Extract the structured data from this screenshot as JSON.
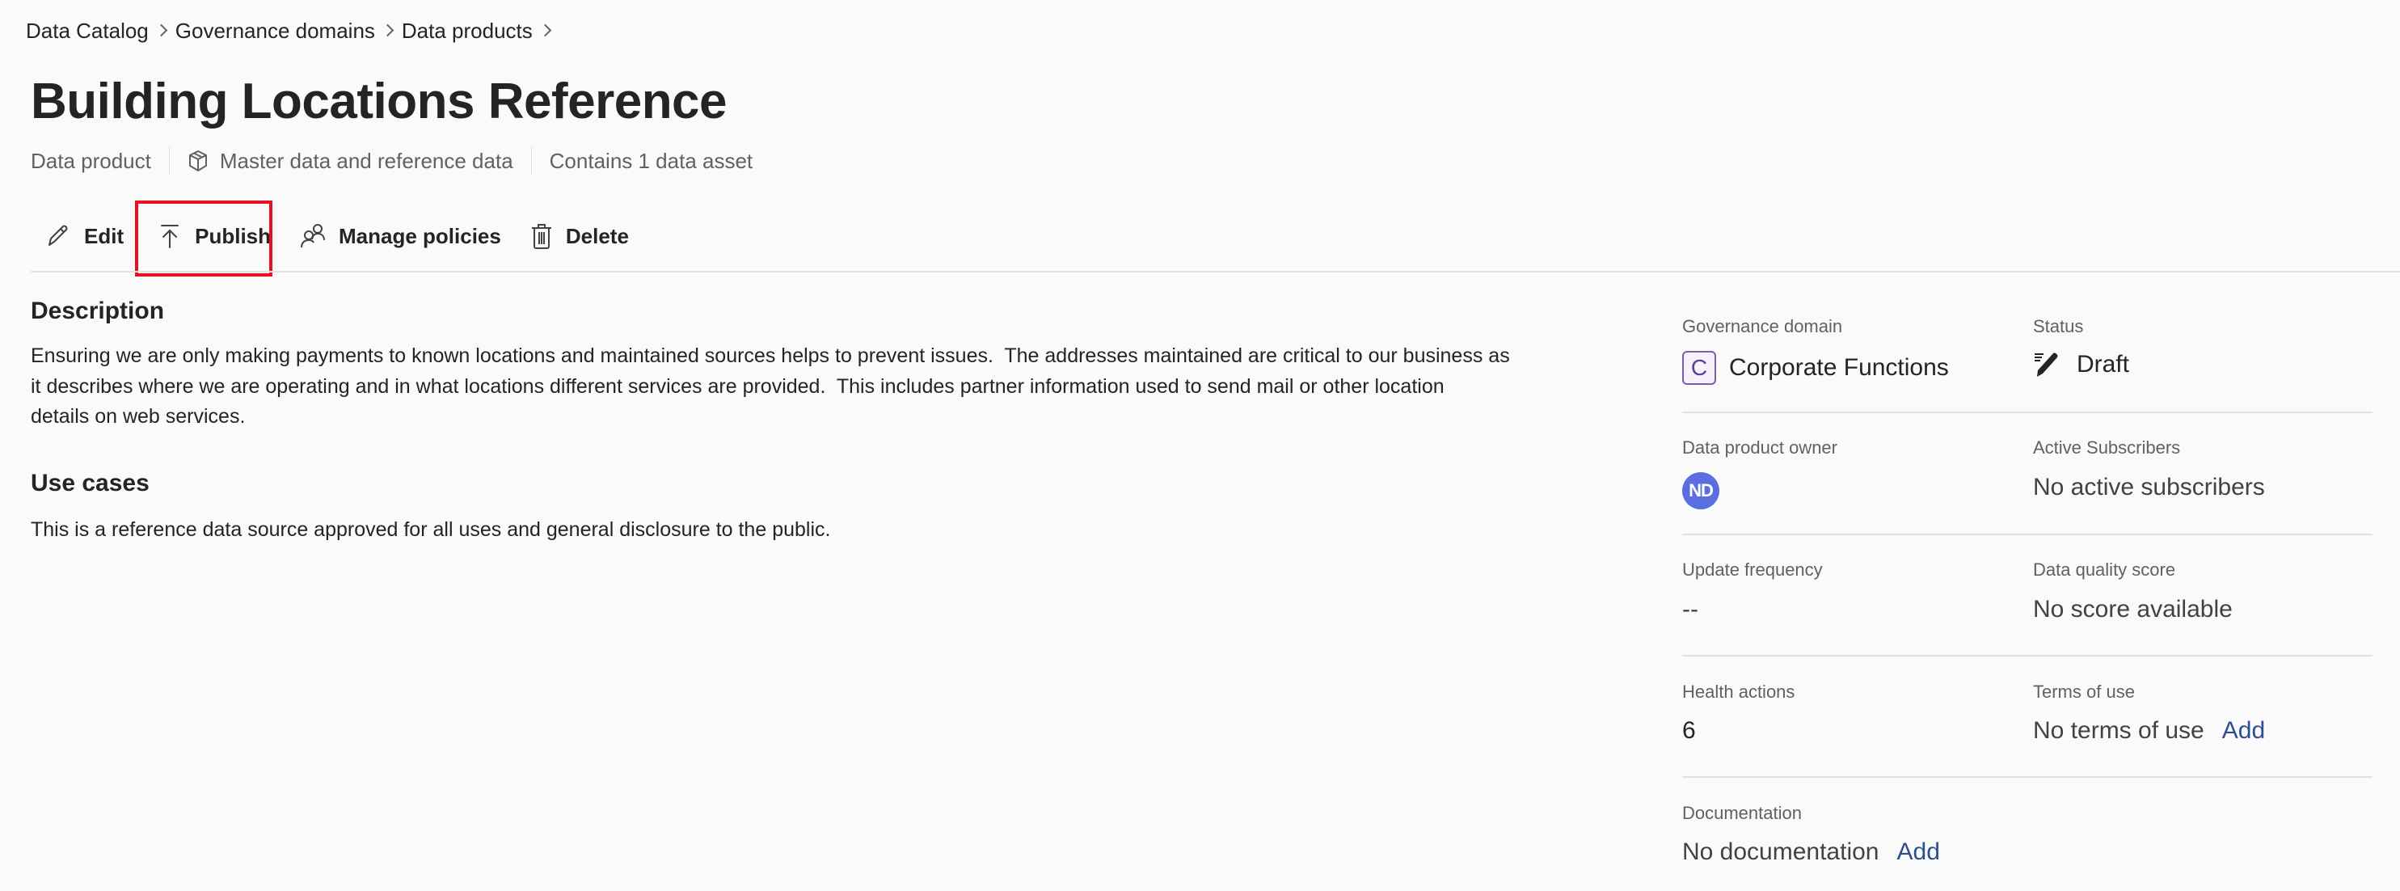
{
  "breadcrumb": {
    "items": [
      "Data Catalog",
      "Governance domains",
      "Data products"
    ]
  },
  "header": {
    "title": "Building Locations Reference",
    "type": "Data product",
    "category": "Master data and reference data",
    "asset_count": "Contains 1 data asset"
  },
  "toolbar": {
    "edit": "Edit",
    "publish": "Publish",
    "manage_policies": "Manage policies",
    "delete": "Delete"
  },
  "highlight": {
    "color": "#e81123",
    "target": "publish"
  },
  "main": {
    "description_heading": "Description",
    "description_lines": [
      "Ensuring we are only making payments to known locations and maintained sources helps to prevent issues.  The addresses maintained are critical to our business as",
      "it describes where we are operating and in what locations different services are provided.  This includes partner information used to send mail or other location",
      "details on web services."
    ],
    "use_cases_heading": "Use cases",
    "use_cases_text": "This is a reference data source approved for all uses and general disclosure to the public."
  },
  "details": {
    "governance_domain": {
      "label": "Governance domain",
      "badge": "C",
      "value": "Corporate Functions"
    },
    "status": {
      "label": "Status",
      "value": "Draft"
    },
    "owner": {
      "label": "Data product owner",
      "initials": "ND"
    },
    "subscribers": {
      "label": "Active Subscribers",
      "value": "No active subscribers"
    },
    "update_frequency": {
      "label": "Update frequency",
      "value": "--"
    },
    "quality_score": {
      "label": "Data quality score",
      "value": "No score available"
    },
    "health_actions": {
      "label": "Health actions",
      "value": "6"
    },
    "terms_of_use": {
      "label": "Terms of use",
      "value": "No terms of use",
      "action": "Add"
    },
    "documentation": {
      "label": "Documentation",
      "value": "No documentation",
      "action": "Add"
    }
  },
  "colors": {
    "link": "#2b4f8f",
    "avatar": "#5b6ee1",
    "domain_badge_border": "#7a5fa8"
  }
}
